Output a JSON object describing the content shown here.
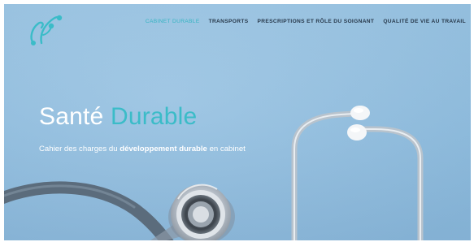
{
  "nav": {
    "items": [
      {
        "label": "CABINET DURABLE",
        "active": true
      },
      {
        "label": "TRANSPORTS",
        "active": false
      },
      {
        "label": "PRESCRIPTIONS ET RÔLE DU SOIGNANT",
        "active": false
      },
      {
        "label": "QUALITÉ DE VIE AU TRAVAIL",
        "active": false
      }
    ]
  },
  "hero": {
    "title_part1": "Santé",
    "title_part2": "Durable",
    "subtitle_part1": "Cahier des charges du",
    "subtitle_bold": "développement durable",
    "subtitle_part2": "en cabinet"
  },
  "colors": {
    "accent": "#3bbcc8",
    "nav_text": "#27384a",
    "background": "#9dc6e4"
  },
  "icons": {
    "logo": "vine-logo-icon",
    "hero_image": "stethoscope-image"
  }
}
